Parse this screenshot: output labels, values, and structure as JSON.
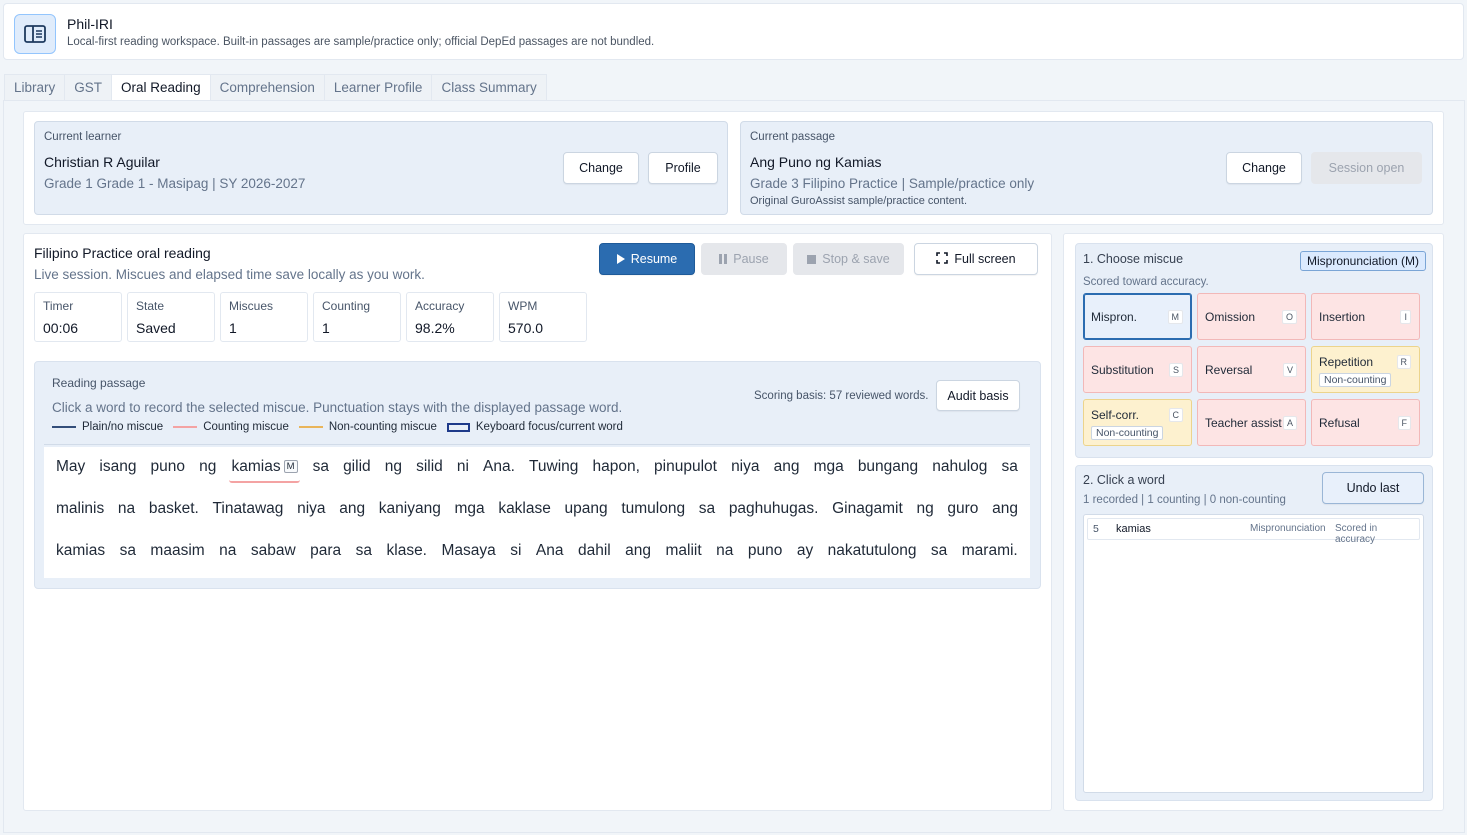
{
  "header": {
    "title": "Phil-IRI",
    "subtitle": "Local-first reading workspace. Built-in passages are sample/practice only; official DepEd passages are not bundled."
  },
  "tabs": [
    {
      "label": "Library",
      "active": false
    },
    {
      "label": "GST",
      "active": false
    },
    {
      "label": "Oral Reading",
      "active": true
    },
    {
      "label": "Comprehension",
      "active": false
    },
    {
      "label": "Learner Profile",
      "active": false
    },
    {
      "label": "Class Summary",
      "active": false
    }
  ],
  "learner": {
    "label": "Current learner",
    "name": "Christian R Aguilar",
    "meta": "Grade 1 Grade 1 - Masipag | SY 2026-2027",
    "change_label": "Change",
    "profile_label": "Profile"
  },
  "passage_info": {
    "label": "Current passage",
    "title": "Ang Puno ng Kamias",
    "meta": "Grade 3 Filipino Practice | Sample/practice only",
    "note": "Original GuroAssist sample/practice content.",
    "change_label": "Change",
    "session_label": "Session open"
  },
  "session": {
    "title": "Filipino Practice oral reading",
    "subtitle": "Live session. Miscues and elapsed time save locally as you work.",
    "resume_label": "Resume",
    "pause_label": "Pause",
    "stop_label": "Stop & save",
    "fullscreen_label": "Full screen"
  },
  "stats": [
    {
      "label": "Timer",
      "value": "00:06"
    },
    {
      "label": "State",
      "value": "Saved"
    },
    {
      "label": "Miscues",
      "value": "1"
    },
    {
      "label": "Counting",
      "value": "1"
    },
    {
      "label": "Accuracy",
      "value": "98.2%"
    },
    {
      "label": "WPM",
      "value": "570.0"
    }
  ],
  "reading": {
    "label": "Reading passage",
    "instructions": "Click a word to record the selected miscue. Punctuation stays with the displayed passage word.",
    "basis": "Scoring basis: 57 reviewed words.",
    "audit_label": "Audit basis",
    "legend": [
      {
        "label": "Plain/no miscue",
        "color": "#334e7a"
      },
      {
        "label": "Counting miscue",
        "color": "#f4a3a3"
      },
      {
        "label": "Non-counting miscue",
        "color": "#e9b55a"
      },
      {
        "label": "Keyboard focus/current word",
        "color": "#1e3a8a"
      }
    ],
    "lines": [
      [
        "May",
        "isang",
        "puno",
        "ng",
        "kamias",
        "sa",
        "gilid",
        "ng",
        "silid",
        "ni",
        "Ana.",
        "Tuwing",
        "hapon,",
        "pinupulot",
        "niya",
        "ang",
        "mga",
        "bungang",
        "nahulog",
        "sa"
      ],
      [
        "malinis",
        "na",
        "basket.",
        "Tinatawag",
        "niya",
        "ang",
        "kaniyang",
        "mga",
        "kaklase",
        "upang",
        "tumulong",
        "sa",
        "paghuhugas.",
        "Ginagamit",
        "ng",
        "guro",
        "ang"
      ],
      [
        "kamias",
        "sa",
        "maasim",
        "na",
        "sabaw",
        "para",
        "sa",
        "klase.",
        "Masaya",
        "si",
        "Ana",
        "dahil",
        "ang",
        "maliit",
        "na",
        "puno",
        "ay",
        "nakatutulong",
        "sa",
        "marami."
      ]
    ],
    "miscue_word": "kamias",
    "miscue_tag": "M"
  },
  "choose": {
    "title": "1. Choose miscue",
    "subtitle": "Scored toward accuracy.",
    "badge": "Mispronunciation (M)",
    "options": [
      {
        "label": "Mispron.",
        "key": "M",
        "kind": "blue",
        "sub": ""
      },
      {
        "label": "Omission",
        "key": "O",
        "kind": "red",
        "sub": ""
      },
      {
        "label": "Insertion",
        "key": "I",
        "kind": "red",
        "sub": ""
      },
      {
        "label": "Substitution",
        "key": "S",
        "kind": "red",
        "sub": ""
      },
      {
        "label": "Reversal",
        "key": "V",
        "kind": "red",
        "sub": ""
      },
      {
        "label": "Repetition",
        "key": "R",
        "kind": "yellow",
        "sub": "Non-counting"
      },
      {
        "label": "Self-corr.",
        "key": "C",
        "kind": "yellow",
        "sub": "Non-counting"
      },
      {
        "label": "Teacher assist",
        "key": "A",
        "kind": "red",
        "sub": ""
      },
      {
        "label": "Refusal",
        "key": "F",
        "kind": "red",
        "sub": ""
      }
    ]
  },
  "word_log": {
    "title": "2. Click a word",
    "summary": "1 recorded | 1 counting | 0 non-counting",
    "undo_label": "Undo last",
    "rows": [
      {
        "index": "5",
        "word": "kamias",
        "type": "Mispronunciation",
        "status": "Scored in accuracy"
      }
    ]
  }
}
